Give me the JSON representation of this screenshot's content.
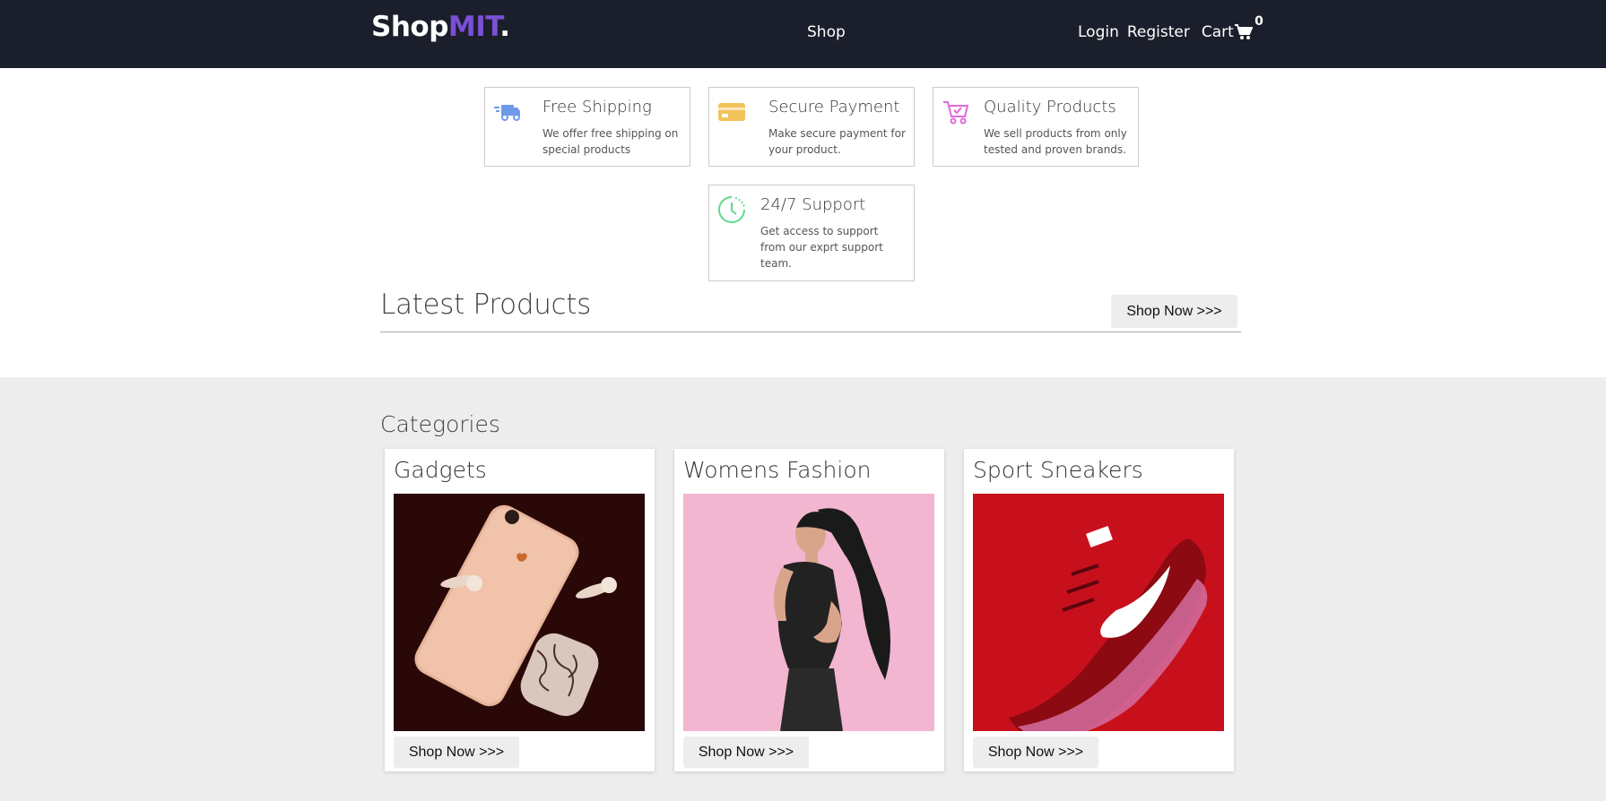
{
  "nav": {
    "brand_main": "Shop",
    "brand_accent": "MIT",
    "brand_dot": ".",
    "shop": "Shop",
    "login": "Login",
    "register": "Register",
    "cart": "Cart",
    "cart_count": "0"
  },
  "features": [
    {
      "title": "Free Shipping",
      "desc": "We offer free shipping on special products",
      "icon": "truck-icon",
      "color": "#6f9ae8"
    },
    {
      "title": "Secure Payment",
      "desc": "Make secure payment for your product.",
      "icon": "card-icon",
      "color": "#f2c25b"
    },
    {
      "title": "Quality Products",
      "desc": "We sell products from only tested and proven brands.",
      "icon": "cart-check-icon",
      "color": "#e06adb"
    },
    {
      "title": "24/7 Support",
      "desc": "Get access to support from our exprt support team.",
      "icon": "clock-icon",
      "color": "#5fd98a"
    }
  ],
  "latest": {
    "title": "Latest Products",
    "button": "Shop Now >>>"
  },
  "categories": {
    "heading": "Categories",
    "items": [
      {
        "title": "Gadgets",
        "button": "Shop Now >>>",
        "image": "phone-and-earbuds-photo"
      },
      {
        "title": "Womens Fashion",
        "button": "Shop Now >>>",
        "image": "woman-pink-background-photo"
      },
      {
        "title": "Sport Sneakers",
        "button": "Shop Now >>>",
        "image": "red-sneaker-photo"
      }
    ]
  }
}
